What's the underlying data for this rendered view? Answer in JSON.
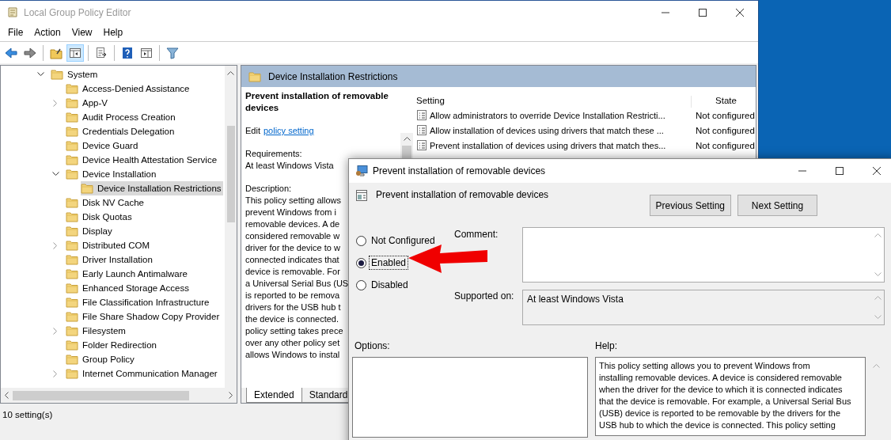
{
  "window": {
    "title": "Local Group Policy Editor"
  },
  "menu": [
    {
      "label": "File"
    },
    {
      "label": "Action"
    },
    {
      "label": "View"
    },
    {
      "label": "Help"
    }
  ],
  "toolbar": [
    {
      "kind": "back",
      "pressed": false
    },
    {
      "kind": "forward",
      "pressed": false
    },
    {
      "kind": "separator"
    },
    {
      "kind": "up",
      "pressed": false
    },
    {
      "kind": "tree",
      "pressed": true
    },
    {
      "kind": "separator"
    },
    {
      "kind": "export",
      "pressed": false
    },
    {
      "kind": "separator"
    },
    {
      "kind": "help",
      "pressed": false
    },
    {
      "kind": "pane",
      "pressed": false
    },
    {
      "kind": "separator"
    },
    {
      "kind": "filter",
      "pressed": false
    }
  ],
  "tree": {
    "items": [
      {
        "label": "System",
        "expandable": true,
        "expanded": true,
        "selected": false,
        "children": [
          {
            "label": "Access-Denied Assistance",
            "expandable": false,
            "selected": false
          },
          {
            "label": "App-V",
            "expandable": true,
            "expanded": false,
            "selected": false
          },
          {
            "label": "Audit Process Creation",
            "expandable": false,
            "selected": false
          },
          {
            "label": "Credentials Delegation",
            "expandable": false,
            "selected": false
          },
          {
            "label": "Device Guard",
            "expandable": false,
            "selected": false
          },
          {
            "label": "Device Health Attestation Service",
            "expandable": false,
            "selected": false
          },
          {
            "label": "Device Installation",
            "expandable": true,
            "expanded": true,
            "selected": false,
            "children": [
              {
                "label": "Device Installation Restrictions",
                "expandable": false,
                "selected": true
              }
            ]
          },
          {
            "label": "Disk NV Cache",
            "expandable": false,
            "selected": false
          },
          {
            "label": "Disk Quotas",
            "expandable": false,
            "selected": false
          },
          {
            "label": "Display",
            "expandable": false,
            "selected": false
          },
          {
            "label": "Distributed COM",
            "expandable": true,
            "expanded": false,
            "selected": false
          },
          {
            "label": "Driver Installation",
            "expandable": false,
            "selected": false
          },
          {
            "label": "Early Launch Antimalware",
            "expandable": false,
            "selected": false
          },
          {
            "label": "Enhanced Storage Access",
            "expandable": false,
            "selected": false
          },
          {
            "label": "File Classification Infrastructure",
            "expandable": false,
            "selected": false
          },
          {
            "label": "File Share Shadow Copy Provider",
            "expandable": false,
            "selected": false
          },
          {
            "label": "Filesystem",
            "expandable": true,
            "expanded": false,
            "selected": false
          },
          {
            "label": "Folder Redirection",
            "expandable": false,
            "selected": false
          },
          {
            "label": "Group Policy",
            "expandable": false,
            "selected": false
          },
          {
            "label": "Internet Communication Manager",
            "expandable": true,
            "expanded": false,
            "selected": false
          }
        ]
      }
    ]
  },
  "details": {
    "header": "Device Installation Restrictions",
    "title": "Prevent installation of removable devices",
    "edit_prefix": "Edit",
    "edit_link": "policy setting",
    "requirements_label": "Requirements:",
    "requirements": "At least Windows Vista",
    "description_label": "Description:",
    "description_lines": [
      "This policy setting allows",
      "prevent Windows from i",
      "removable devices. A de",
      "considered removable w",
      "driver for the device to w",
      "connected indicates that",
      "device is removable. For",
      "a Universal Serial Bus (US",
      "is reported to be remova",
      "drivers for the USB hub t",
      "the device is connected.",
      "policy setting takes prece",
      "over any other policy set",
      "allows Windows to instal"
    ]
  },
  "table": {
    "columns": [
      "Setting",
      "State"
    ],
    "rows": [
      {
        "setting": "Allow administrators to override Device Installation Restricti...",
        "state": "Not configured"
      },
      {
        "setting": "Allow installation of devices using drivers that match these ...",
        "state": "Not configured"
      },
      {
        "setting": "Prevent installation of devices using drivers that match thes...",
        "state": "Not configured"
      }
    ]
  },
  "view_tabs": [
    {
      "label": "Extended",
      "selected": true
    },
    {
      "label": "Standard",
      "selected": false
    }
  ],
  "status_bar": {
    "text": "10 setting(s)"
  },
  "dialog": {
    "title": "Prevent installation of removable devices",
    "header": "Prevent installation of removable devices",
    "buttons": [
      {
        "label": "Previous Setting"
      },
      {
        "label": "Next Setting"
      }
    ],
    "options": [
      {
        "label": "Not Configured",
        "selected": false,
        "focused": false
      },
      {
        "label": "Enabled",
        "selected": true,
        "focused": true
      },
      {
        "label": "Disabled",
        "selected": false,
        "focused": false
      }
    ],
    "comment_label": "Comment:",
    "supported_label": "Supported on:",
    "supported": "At least Windows Vista",
    "options_label": "Options:",
    "help_label": "Help:",
    "help_lines": [
      "This policy setting allows you to prevent Windows from",
      "installing removable devices. A device is considered removable",
      "when the driver for the device to which it is connected indicates",
      "that the device is removable. For example, a Universal Serial Bus",
      "(USB) device is reported to be removable by the drivers for the",
      "USB hub to which the device is connected. This policy setting"
    ]
  }
}
